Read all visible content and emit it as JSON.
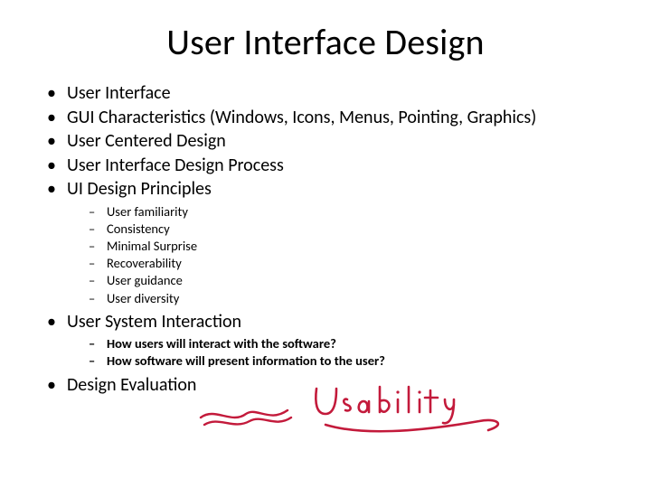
{
  "title": "User Interface Design",
  "bullets": {
    "b0": "User Interface",
    "b1": "GUI Characteristics (Windows, Icons, Menus, Pointing, Graphics)",
    "b2": "User Centered Design",
    "b3": "User Interface Design Process",
    "b4": "UI Design Principles",
    "b4_sub": {
      "s0": "User familiarity",
      "s1": "Consistency",
      "s2": "Minimal Surprise",
      "s3": "Recoverability",
      "s4": "User guidance",
      "s5": "User diversity"
    },
    "b5": "User System Interaction",
    "b5_sub": {
      "s0": "How users will interact with the software?",
      "s1": "How software will present information to the user?"
    },
    "b6": "Design Evaluation"
  },
  "handwriting": {
    "word": "Usability",
    "ink_color": "#c31a3b"
  }
}
